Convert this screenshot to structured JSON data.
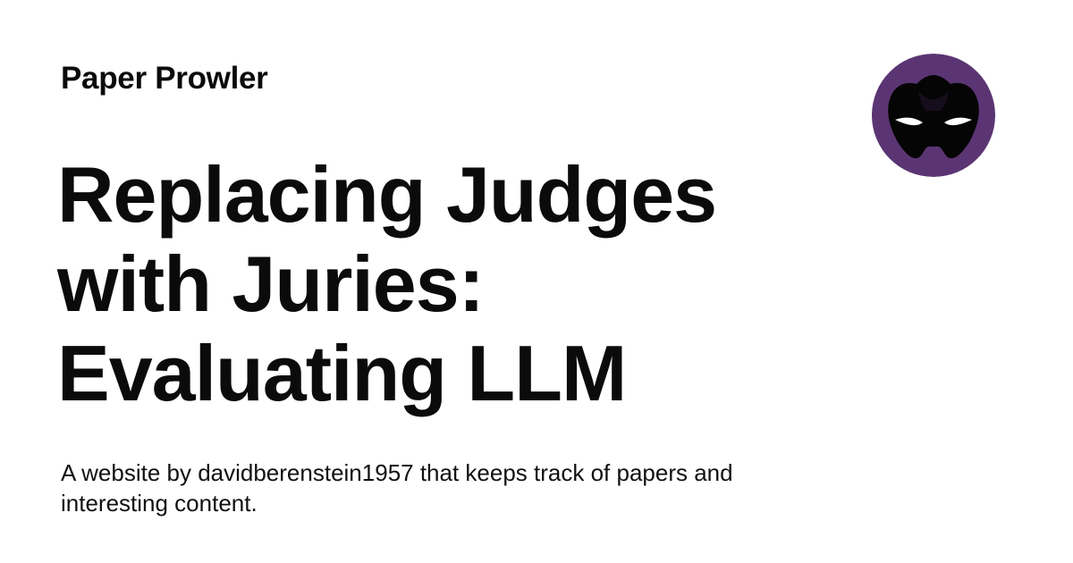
{
  "site": {
    "name": "Paper Prowler"
  },
  "article": {
    "title": "Replacing Judges with Juries: Evaluating LLM",
    "description": "A website by davidberenstein1957 that keeps track of papers and interesting content."
  },
  "avatar": {
    "icon": "masked-face-icon",
    "background_color": "#5b3573",
    "mask_color": "#050505",
    "eye_color": "#ffffff"
  }
}
